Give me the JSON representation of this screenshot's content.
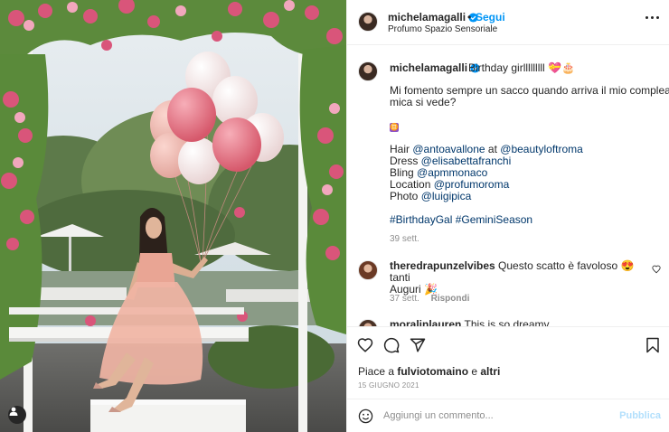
{
  "post": {
    "author": {
      "username": "michelamagalli",
      "verified": true,
      "location": "Profumo Spazio Sensoriale",
      "follow_label": "Segui",
      "separator": "•"
    },
    "caption": {
      "username": "michelamagalli",
      "first_line": "Birthday girlllllllll 💝🎂",
      "text_line_1": "Mi fomento sempre un sacco quando arriva il mio compleanno,",
      "text_line_2": "mica si vede?",
      "zodiac": "♊",
      "credits": [
        {
          "prefix": "Hair ",
          "handle_1": "@antoavallone",
          "mid": " at ",
          "handle_2": "@beautyloftroma"
        },
        {
          "prefix": "Dress ",
          "handle_1": "@elisabettafranchi"
        },
        {
          "prefix": "Bling ",
          "handle_1": "@apmmonaco"
        },
        {
          "prefix": "Location ",
          "handle_1": "@profumoroma"
        },
        {
          "prefix": "Photo ",
          "handle_1": "@luigipica"
        }
      ],
      "hashtags": "#BirthdayGal #GeminiSeason",
      "age": "39 sett."
    },
    "comments": [
      {
        "username": "theredrapunzelvibes",
        "text_line_1": "Questo scatto è favoloso 😍 tanti",
        "text_line_2": "Auguri 🎉",
        "age": "37 sett.",
        "reply_label": "Rispondi"
      },
      {
        "username": "moralinlauren",
        "text_line_1": "This is so dreamy"
      }
    ],
    "likes": {
      "prefix": "Piace a ",
      "user": "fulviotomaino",
      "mid": " e ",
      "others": "altri"
    },
    "date": "15 GIUGNO 2021",
    "comment_box": {
      "placeholder": "Aggiungi un commento...",
      "publish_label": "Pubblica"
    },
    "colors": {
      "accent": "#0095f6",
      "link": "#00376b",
      "muted": "#8e8e8e",
      "publish_disabled": "#b2dffc"
    },
    "icons": [
      "verified-icon",
      "more-icon",
      "heart-icon",
      "comment-icon",
      "share-icon",
      "bookmark-icon",
      "emoji-icon",
      "user-tag-icon"
    ]
  }
}
